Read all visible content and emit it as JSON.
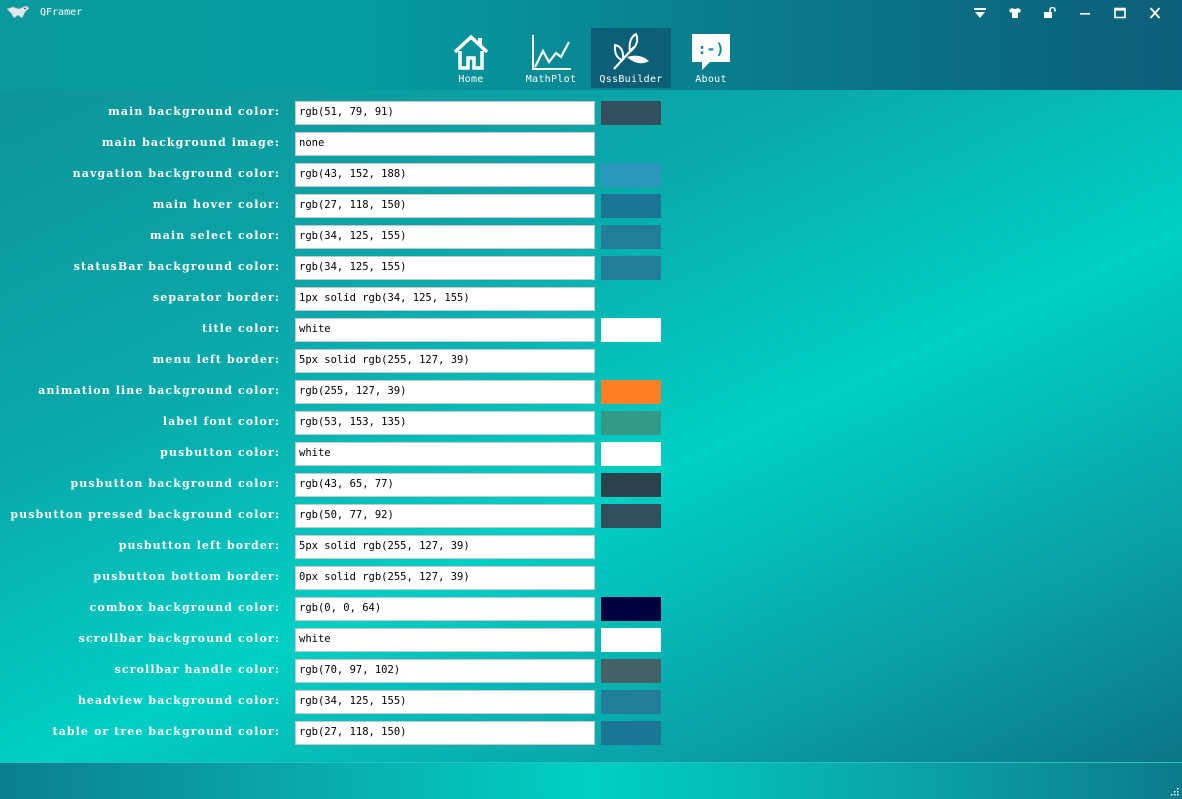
{
  "window": {
    "title": "QFramer",
    "controls": [
      "menu-icon",
      "skin-icon",
      "lock-icon",
      "minimize-icon",
      "maximize-icon",
      "close-icon"
    ]
  },
  "nav": {
    "active": "QssBuilder",
    "items": [
      {
        "label": "Home",
        "icon": "home-icon"
      },
      {
        "label": "MathPlot",
        "icon": "chart-icon"
      },
      {
        "label": "QssBuilder",
        "icon": "leaf-icon"
      },
      {
        "label": "About",
        "icon": "smiley-chat-icon"
      }
    ]
  },
  "settings": [
    {
      "label": "main background color:",
      "value": "rgb(51, 79, 91)",
      "swatch": "#334f5b"
    },
    {
      "label": "main background image:",
      "value": "none",
      "swatch": ""
    },
    {
      "label": "navgation background color:",
      "value": "rgb(43, 152, 188)",
      "swatch": "#2b98bc"
    },
    {
      "label": "main hover color:",
      "value": "rgb(27, 118, 150)",
      "swatch": "#1b7696"
    },
    {
      "label": "main select color:",
      "value": "rgb(34, 125, 155)",
      "swatch": "#227d9b"
    },
    {
      "label": "statusBar background color:",
      "value": "rgb(34, 125, 155)",
      "swatch": "#227d9b"
    },
    {
      "label": "separator border:",
      "value": "1px solid rgb(34, 125, 155)",
      "swatch": ""
    },
    {
      "label": "title color:",
      "value": "white",
      "swatch": "#ffffff"
    },
    {
      "label": "menu left border:",
      "value": "5px solid rgb(255, 127, 39)",
      "swatch": ""
    },
    {
      "label": "animation line background color:",
      "value": "rgb(255, 127, 39)",
      "swatch": "#ff7f27"
    },
    {
      "label": "label font color:",
      "value": "rgb(53, 153, 135)",
      "swatch": "#359987"
    },
    {
      "label": "pusbutton color:",
      "value": "white",
      "swatch": "#ffffff"
    },
    {
      "label": "pusbutton background color:",
      "value": "rgb(43, 65, 77)",
      "swatch": "#2b414d"
    },
    {
      "label": "pusbutton pressed background color:",
      "value": "rgb(50, 77, 92)",
      "swatch": "#324d5c"
    },
    {
      "label": "pusbutton left border:",
      "value": "5px solid rgb(255, 127, 39)",
      "swatch": ""
    },
    {
      "label": "pusbutton bottom border:",
      "value": "0px solid rgb(255, 127, 39)",
      "swatch": ""
    },
    {
      "label": "combox background color:",
      "value": "rgb(0, 0, 64)",
      "swatch": "#000040"
    },
    {
      "label": "scrollbar background color:",
      "value": "white",
      "swatch": "#ffffff"
    },
    {
      "label": "scrollbar handle color:",
      "value": "rgb(70, 97, 102)",
      "swatch": "#466166"
    },
    {
      "label": "headview background color:",
      "value": "rgb(34, 125, 155)",
      "swatch": "#227d9b"
    },
    {
      "label": "table or tree background color:",
      "value": "rgb(27, 118, 150)",
      "swatch": "#1b7696"
    }
  ]
}
